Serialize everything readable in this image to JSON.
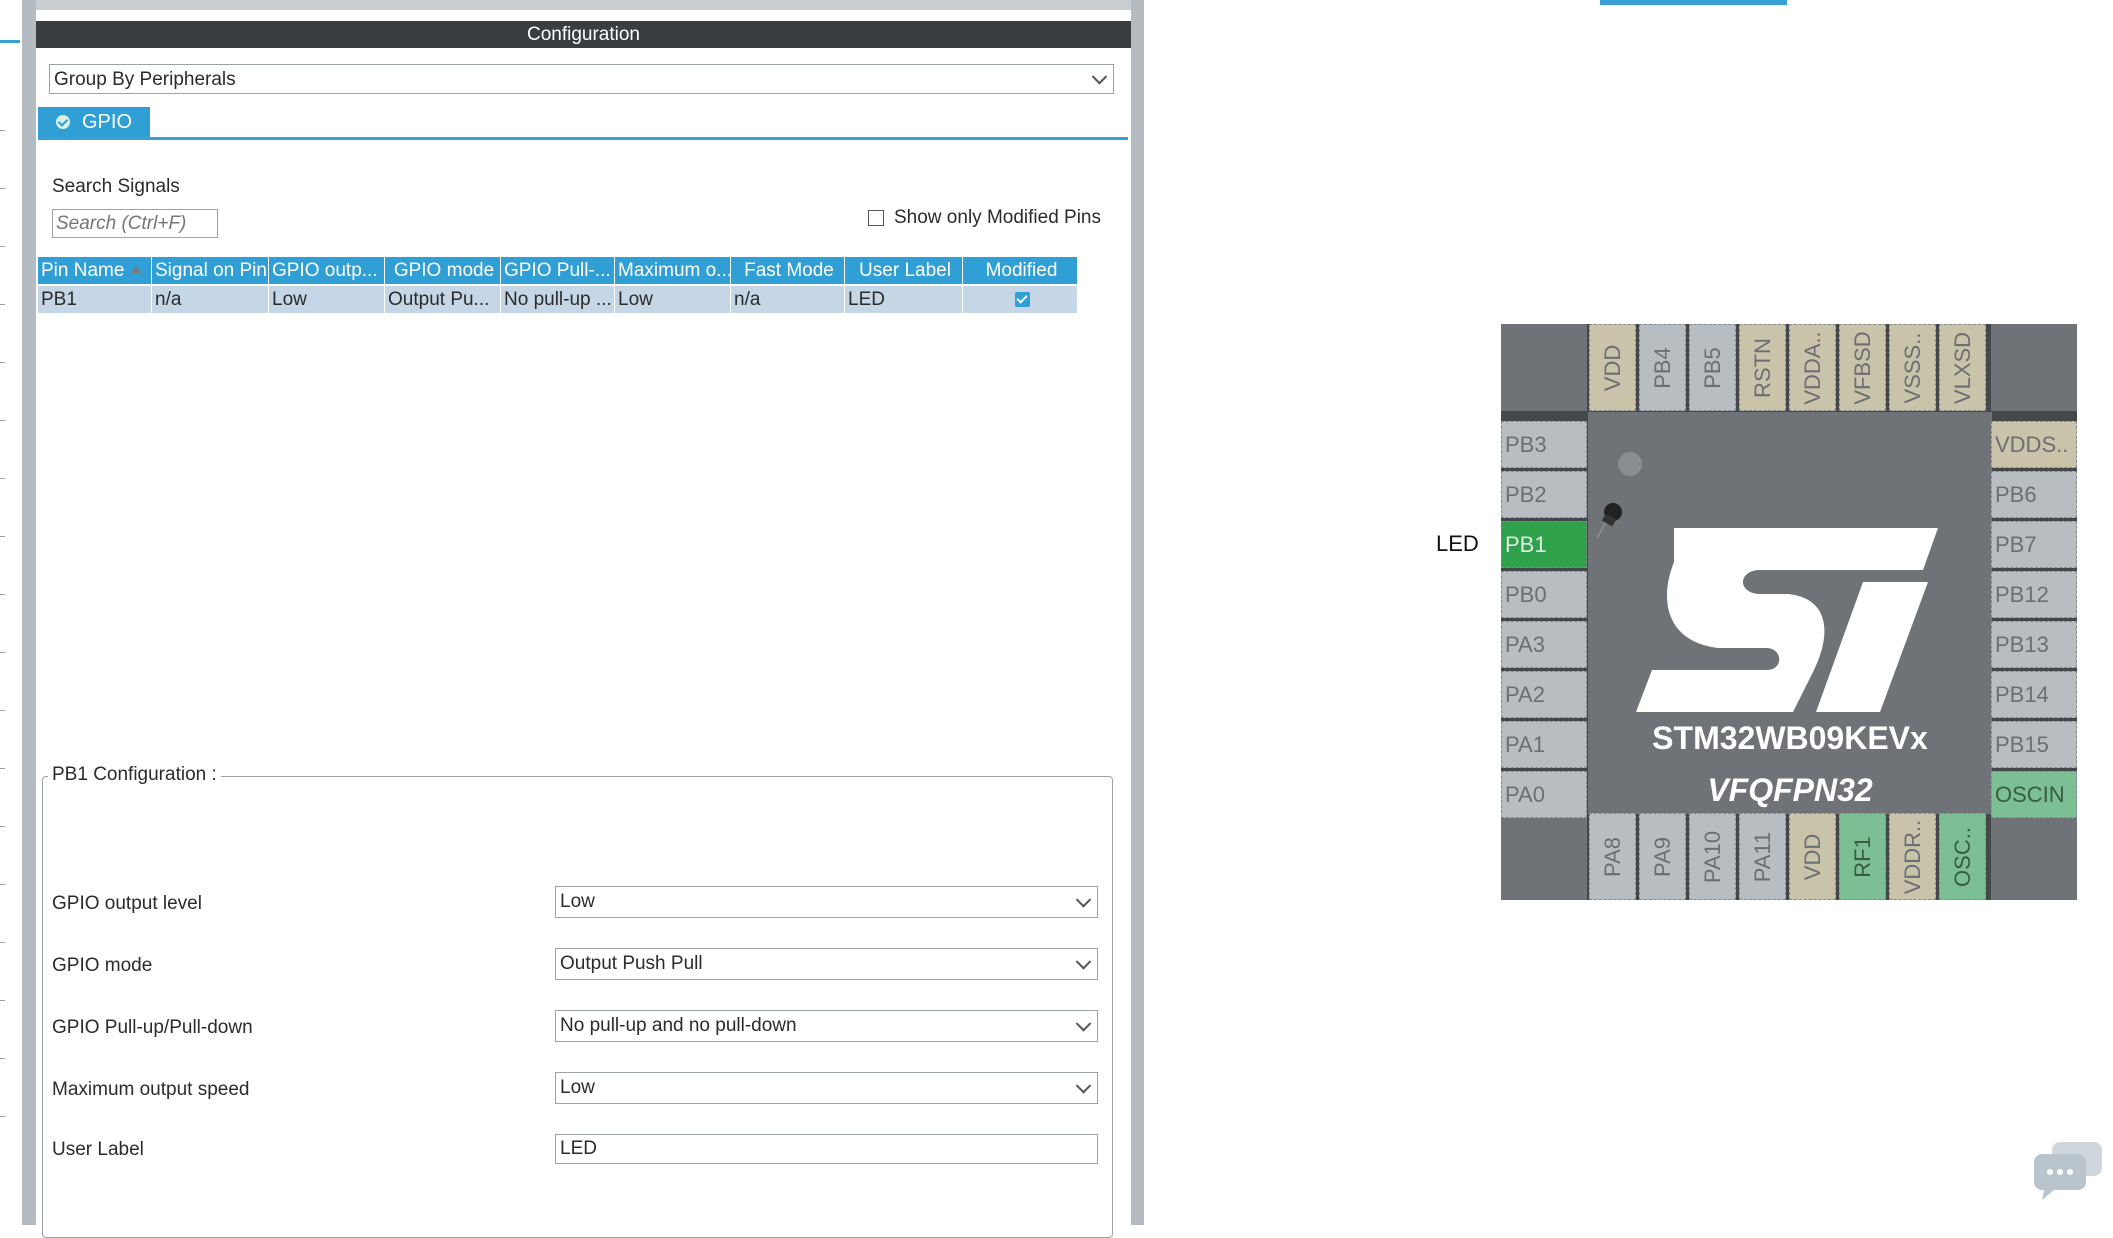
{
  "config": {
    "title": "Configuration",
    "group_by": "Group By Peripherals",
    "tab_label": "GPIO",
    "search_label": "Search Signals",
    "search_placeholder": "Search (Ctrl+F)",
    "show_modified_label": "Show only Modified Pins"
  },
  "table": {
    "headers": [
      "Pin Name",
      "Signal on Pin",
      "GPIO outp...",
      "GPIO mode",
      "GPIO Pull-...",
      "Maximum o...",
      "Fast Mode",
      "User Label",
      "Modified"
    ],
    "rows": [
      {
        "cells": [
          "PB1",
          "n/a",
          "Low",
          "Output Pu...",
          "No pull-up ...",
          "Low",
          "n/a",
          "LED"
        ],
        "modified": true
      }
    ]
  },
  "pin_config": {
    "title": "PB1 Configuration :",
    "fields": [
      {
        "label": "GPIO output level",
        "value": "Low"
      },
      {
        "label": "GPIO mode",
        "value": "Output Push Pull"
      },
      {
        "label": "GPIO Pull-up/Pull-down",
        "value": "No pull-up and no pull-down"
      },
      {
        "label": "Maximum output speed",
        "value": "Low"
      },
      {
        "label": "User Label",
        "value": "LED"
      }
    ]
  },
  "chip": {
    "name": "STM32WB09KEVx",
    "package": "VFQFPN32",
    "led_label": "LED",
    "left_pins": [
      "PB3",
      "PB2",
      "PB1",
      "PB0",
      "PA3",
      "PA2",
      "PA1",
      "PA0"
    ],
    "right_pins": [
      "VDDS..",
      "PB6",
      "PB7",
      "PB12",
      "PB13",
      "PB14",
      "PB15",
      "OSCIN"
    ],
    "top_pins": [
      "VDD",
      "PB4",
      "PB5",
      "RSTN",
      "VDDA..",
      "VFBSD",
      "VSSS..",
      "VLXSD"
    ],
    "bottom_pins": [
      "PA8",
      "PA9",
      "PA10",
      "PA11",
      "VDD",
      "RF1",
      "VDDR..",
      "OSC.."
    ],
    "colors": {
      "assigned": "#2fa14b",
      "power": "#c8c3a9",
      "special": "#7cbf94",
      "free": "#b8bdc1"
    }
  }
}
